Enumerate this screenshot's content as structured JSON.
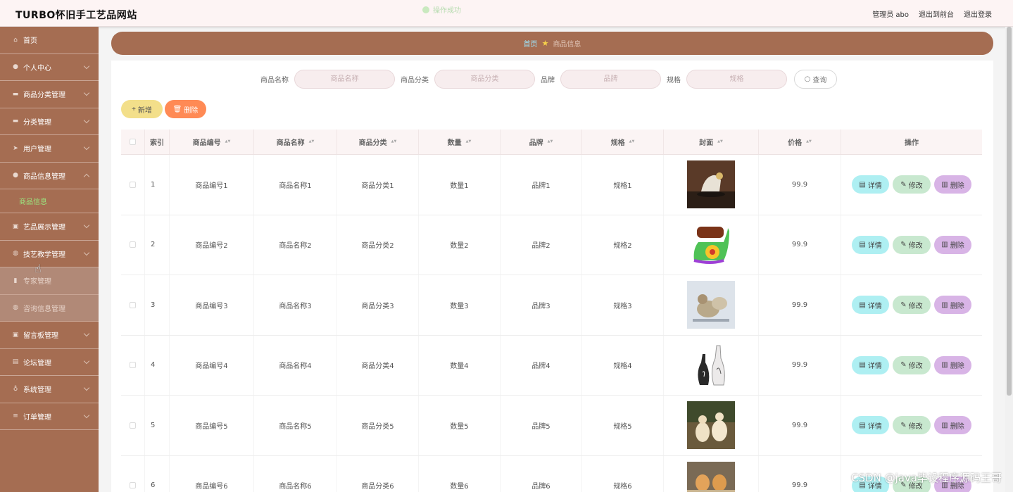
{
  "header": {
    "site_title": "TURBO怀旧手工艺品网站",
    "toast": "操作成功",
    "user": "管理员 abo",
    "to_front": "退出到前台",
    "logout": "退出登录"
  },
  "sidebar": {
    "items": [
      {
        "label": "首页",
        "icon": "home-icon"
      },
      {
        "label": "个人中心",
        "icon": "user-icon"
      },
      {
        "label": "商品分类管理",
        "icon": "category-icon"
      },
      {
        "label": "分类管理",
        "icon": "monitor-icon"
      },
      {
        "label": "用户管理",
        "icon": "send-icon"
      },
      {
        "label": "商品信息管理",
        "icon": "user-icon",
        "expanded": true
      },
      {
        "label": "商品信息",
        "sub": true
      },
      {
        "label": "艺品展示管理",
        "icon": "briefcase-icon"
      },
      {
        "label": "技艺教学管理",
        "icon": "globe-icon"
      },
      {
        "label": "专家管理",
        "icon": "chart-icon"
      },
      {
        "label": "咨询信息管理",
        "icon": "globe-icon"
      },
      {
        "label": "留言板管理",
        "icon": "briefcase-icon"
      },
      {
        "label": "论坛管理",
        "icon": "doc-icon"
      },
      {
        "label": "系统管理",
        "icon": "bulb-icon"
      },
      {
        "label": "订单管理",
        "icon": "list-icon"
      }
    ]
  },
  "breadcrumb": {
    "home": "首页",
    "current": "商品信息"
  },
  "search": {
    "name_label": "商品名称",
    "name_placeholder": "商品名称",
    "cat_label": "商品分类",
    "cat_placeholder": "商品分类",
    "brand_label": "品牌",
    "brand_placeholder": "品牌",
    "spec_label": "规格",
    "spec_placeholder": "规格",
    "query_label": "查询"
  },
  "actions": {
    "add_label": "新增",
    "delete_label": "删除"
  },
  "table": {
    "headers": {
      "index": "索引",
      "code": "商品编号",
      "name": "商品名称",
      "cat": "商品分类",
      "qty": "数量",
      "brand": "品牌",
      "spec": "规格",
      "cover": "封面",
      "price": "价格",
      "ops": "操作"
    },
    "op_labels": {
      "detail": "详情",
      "edit": "修改",
      "delete": "删除"
    },
    "rows": [
      {
        "index": "1",
        "code": "商品编号1",
        "name": "商品名称1",
        "cat": "商品分类1",
        "qty": "数量1",
        "brand": "品牌1",
        "spec": "规格1",
        "price": "99.9"
      },
      {
        "index": "2",
        "code": "商品编号2",
        "name": "商品名称2",
        "cat": "商品分类2",
        "qty": "数量2",
        "brand": "品牌2",
        "spec": "规格2",
        "price": "99.9"
      },
      {
        "index": "3",
        "code": "商品编号3",
        "name": "商品名称3",
        "cat": "商品分类3",
        "qty": "数量3",
        "brand": "品牌3",
        "spec": "规格3",
        "price": "99.9"
      },
      {
        "index": "4",
        "code": "商品编号4",
        "name": "商品名称4",
        "cat": "商品分类4",
        "qty": "数量4",
        "brand": "品牌4",
        "spec": "规格4",
        "price": "99.9"
      },
      {
        "index": "5",
        "code": "商品编号5",
        "name": "商品名称5",
        "cat": "商品分类5",
        "qty": "数量5",
        "brand": "品牌5",
        "spec": "规格5",
        "price": "99.9"
      },
      {
        "index": "6",
        "code": "商品编号6",
        "name": "商品名称6",
        "cat": "商品分类6",
        "qty": "数量6",
        "brand": "品牌6",
        "spec": "规格6",
        "price": "99.9"
      }
    ]
  },
  "watermark": "CSDN @java毕设程序源码王哥",
  "colors": {
    "sidebar": "#a56d52",
    "accent_green": "#9be57f",
    "delete": "#ff8a55",
    "add": "#f3df8a"
  }
}
